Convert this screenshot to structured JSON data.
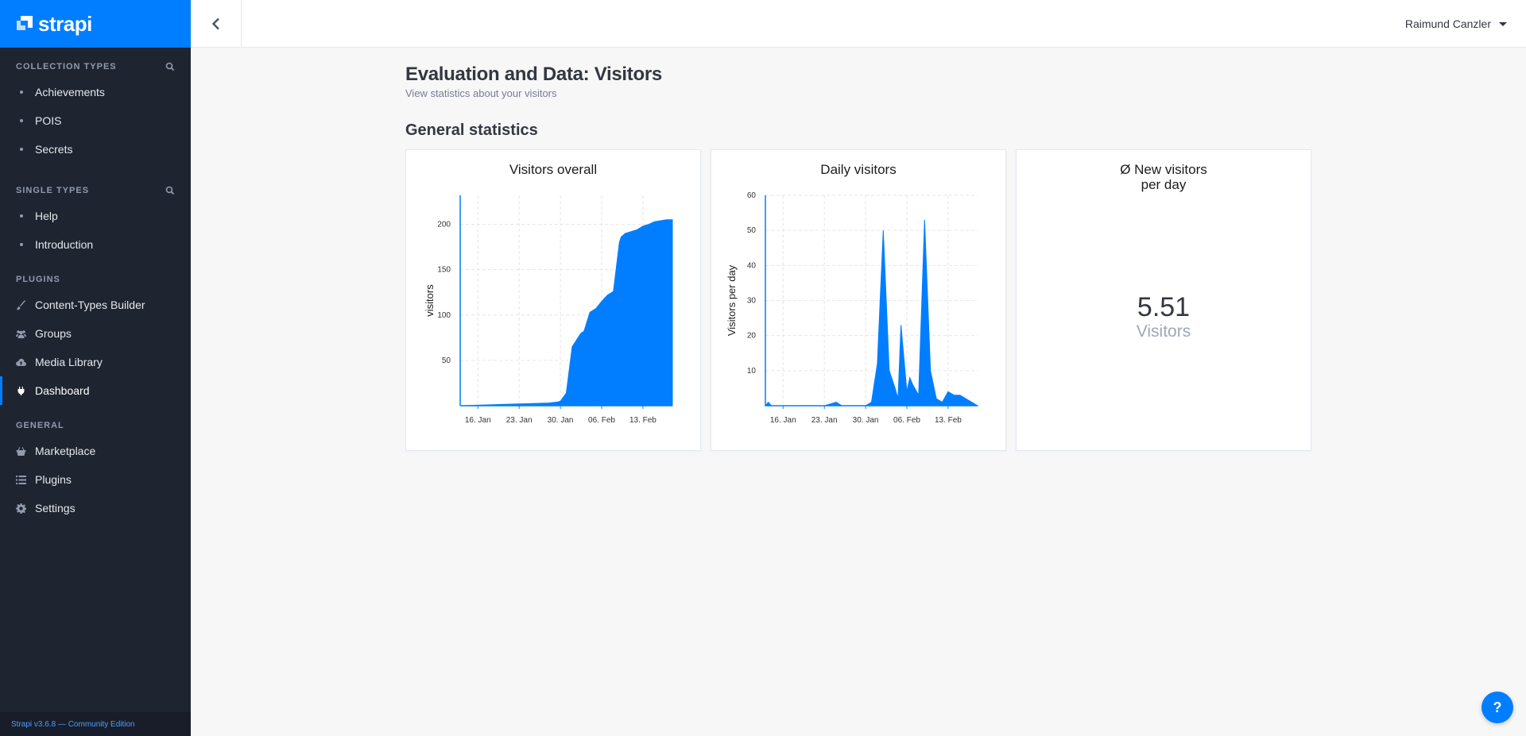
{
  "brand": {
    "name": "strapi"
  },
  "sidebar": {
    "collection_types": {
      "title": "Collection Types",
      "items": [
        {
          "label": "Achievements"
        },
        {
          "label": "POIS"
        },
        {
          "label": "Secrets"
        }
      ]
    },
    "single_types": {
      "title": "Single Types",
      "items": [
        {
          "label": "Help"
        },
        {
          "label": "Introduction"
        }
      ]
    },
    "plugins": {
      "title": "Plugins",
      "items": [
        {
          "label": "Content-Types Builder",
          "icon": "paintbrush-icon"
        },
        {
          "label": "Groups",
          "icon": "users-icon"
        },
        {
          "label": "Media Library",
          "icon": "cloud-upload-icon"
        },
        {
          "label": "Dashboard",
          "icon": "plug-icon",
          "active": true
        }
      ]
    },
    "general": {
      "title": "General",
      "items": [
        {
          "label": "Marketplace",
          "icon": "shopping-basket-icon"
        },
        {
          "label": "Plugins",
          "icon": "list-icon"
        },
        {
          "label": "Settings",
          "icon": "gear-icon"
        }
      ]
    },
    "footer": "Strapi v3.6.8 — Community Edition"
  },
  "header": {
    "user_name": "Raimund Canzler"
  },
  "page": {
    "title": "Evaluation and Data: Visitors",
    "subtitle": "View statistics about your visitors",
    "section_title": "General statistics"
  },
  "cards": {
    "overall": {
      "title": "Visitors overall"
    },
    "daily": {
      "title": "Daily visitors"
    },
    "new": {
      "title_line1": "Ø New visitors",
      "title_line2": "per day",
      "value": "5.51",
      "unit": "Visitors"
    }
  },
  "colors": {
    "accent": "#007eff",
    "sidebar_bg": "#1e2430"
  },
  "chart_data": [
    {
      "type": "area",
      "title": "Visitors overall",
      "ylabel": "visitors",
      "xlabel": "",
      "x_ticks": [
        "16. Jan",
        "23. Jan",
        "30. Jan",
        "06. Feb",
        "13. Feb"
      ],
      "x_tick_days": [
        3,
        10,
        17,
        24,
        31
      ],
      "xlim": [
        0,
        36
      ],
      "ylim": [
        0,
        232
      ],
      "y_ticks": [
        50,
        100,
        150,
        200
      ],
      "grid": true,
      "series": [
        {
          "x": [
            0,
            5,
            10,
            15,
            16.5,
            17,
            18,
            19,
            20,
            20.5,
            21,
            22,
            22.5,
            23,
            24,
            25,
            26,
            27,
            27.3,
            28,
            29,
            30,
            31,
            32,
            33,
            34,
            35,
            36
          ],
          "y": [
            0,
            1,
            2,
            3,
            4,
            5,
            14,
            65,
            75,
            80,
            82,
            103,
            105,
            107,
            115,
            122,
            126,
            180,
            186,
            190,
            192,
            194,
            198,
            200,
            203,
            204,
            205,
            205
          ]
        }
      ]
    },
    {
      "type": "area",
      "title": "Daily visitors",
      "ylabel": "Visitors per day",
      "xlabel": "",
      "x_ticks": [
        "16. Jan",
        "23. Jan",
        "30. Jan",
        "06. Feb",
        "13. Feb"
      ],
      "x_tick_days": [
        3,
        10,
        17,
        24,
        31
      ],
      "xlim": [
        0,
        36
      ],
      "ylim": [
        0,
        60
      ],
      "y_ticks": [
        10,
        20,
        30,
        40,
        50,
        60
      ],
      "grid": true,
      "series": [
        {
          "x": [
            0,
            0.5,
            1,
            10,
            11,
            12,
            13,
            17,
            18,
            19,
            20,
            21,
            22,
            22.5,
            23,
            24,
            24.5,
            25,
            26,
            27,
            28,
            29,
            30,
            31,
            32,
            33,
            34,
            35,
            36
          ],
          "y": [
            0,
            1,
            0,
            0,
            0.5,
            1,
            0,
            0,
            1,
            12,
            50,
            10,
            5,
            2,
            23,
            4,
            8,
            6,
            3,
            53,
            10,
            2,
            1,
            4,
            3,
            3,
            2,
            1,
            0
          ]
        }
      ]
    }
  ]
}
